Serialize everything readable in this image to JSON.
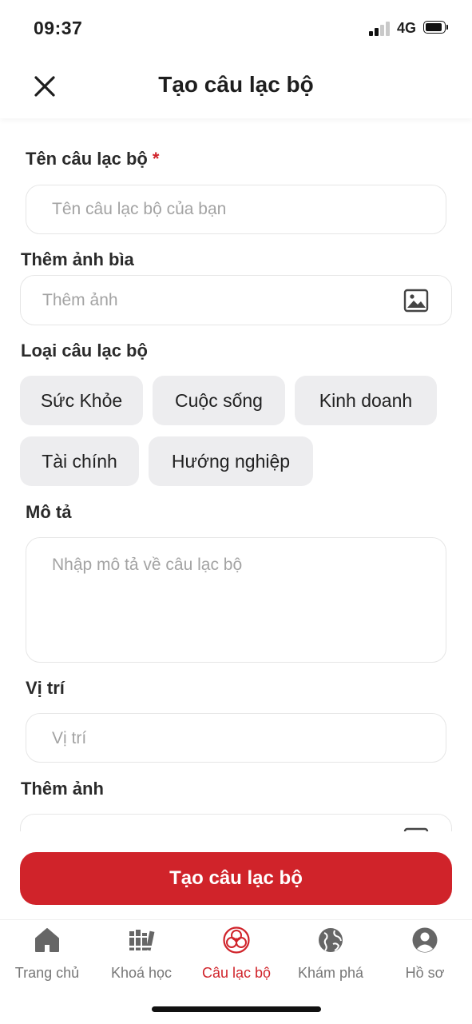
{
  "status_bar": {
    "time": "09:37",
    "network": "4G"
  },
  "header": {
    "title": "Tạo câu lạc bộ"
  },
  "form": {
    "club_name": {
      "label": "Tên câu lạc bộ",
      "required_mark": "*",
      "placeholder": "Tên câu lạc bộ của bạn"
    },
    "cover_image": {
      "label": "Thêm ảnh bìa",
      "placeholder": "Thêm ảnh"
    },
    "club_type": {
      "label": "Loại câu lạc bộ",
      "options": [
        "Sức Khỏe",
        "Cuộc sống",
        "Kinh doanh",
        "Tài chính",
        "Hướng nghiệp"
      ]
    },
    "description": {
      "label": "Mô tả",
      "placeholder": "Nhập mô tả về câu lạc bộ"
    },
    "location": {
      "label": "Vị trí",
      "placeholder": "Vị trí"
    },
    "add_image": {
      "label": "Thêm ảnh"
    }
  },
  "submit_label": "Tạo câu lạc bộ",
  "tabs": [
    {
      "label": "Trang chủ",
      "icon": "home-icon"
    },
    {
      "label": "Khoá học",
      "icon": "books-icon"
    },
    {
      "label": "Câu lạc bộ",
      "icon": "club-icon",
      "active": true
    },
    {
      "label": "Khám phá",
      "icon": "globe-icon"
    },
    {
      "label": "Hồ sơ",
      "icon": "profile-icon"
    }
  ],
  "colors": {
    "accent": "#d0232a",
    "chip_bg": "#ededef",
    "placeholder": "#a3a3a3",
    "tab_inactive": "#777777"
  }
}
